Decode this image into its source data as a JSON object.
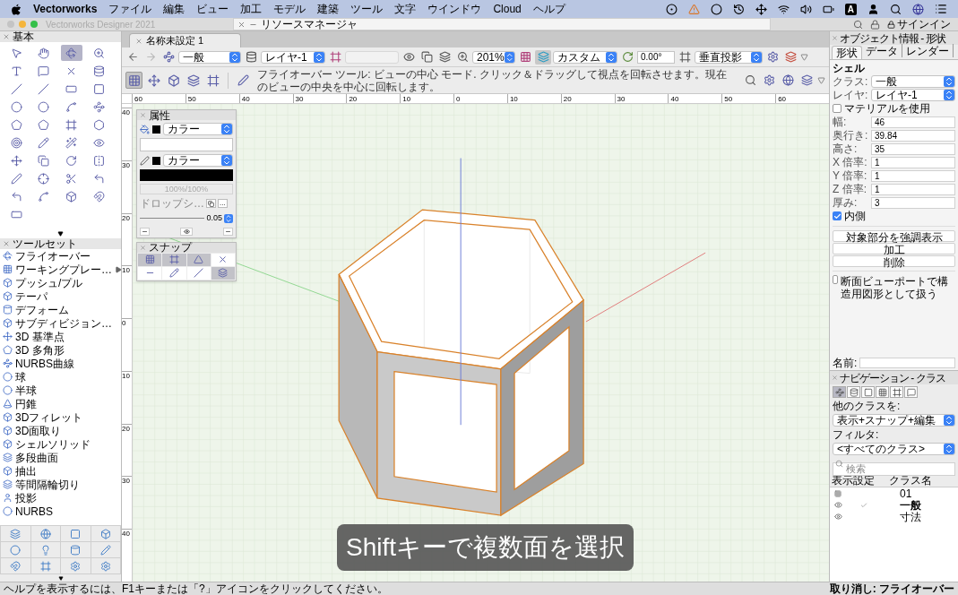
{
  "menu_bar": {
    "app": "Vectorworks",
    "items": [
      "ファイル",
      "編集",
      "ビュー",
      "加工",
      "モデル",
      "建築",
      "ツール",
      "文字",
      "ウインドウ",
      "Cloud",
      "ヘルプ"
    ],
    "input_mode": "A"
  },
  "window": {
    "title": "Vectorworks Designer 2021",
    "resource_manager": "リソースマネージャ",
    "sign_in": "サインイン"
  },
  "basic_palette": {
    "title": "基本",
    "tools": [
      {
        "selected": false
      },
      {
        "selected": false
      },
      {
        "selected": true
      },
      {
        "selected": false
      },
      {
        "selected": false
      },
      {
        "selected": false
      },
      {
        "selected": false
      },
      {
        "selected": false
      },
      {
        "selected": false
      },
      {
        "selected": false
      },
      {
        "selected": false
      },
      {
        "selected": false
      },
      {
        "selected": false
      },
      {
        "selected": false
      },
      {
        "selected": false
      },
      {
        "selected": false
      },
      {
        "selected": false
      },
      {
        "selected": false
      },
      {
        "selected": false
      },
      {
        "selected": false
      },
      {
        "selected": false
      },
      {
        "selected": false
      },
      {
        "selected": false
      },
      {
        "selected": false
      },
      {
        "selected": false
      },
      {
        "selected": false
      },
      {
        "selected": false
      },
      {
        "selected": false
      },
      {
        "selected": false
      },
      {
        "selected": false
      },
      {
        "selected": false
      },
      {
        "selected": false
      },
      {
        "selected": false
      },
      {
        "selected": false
      },
      {
        "selected": false
      },
      {
        "selected": false
      },
      {
        "selected": false
      }
    ]
  },
  "toolset": {
    "title": "ツールセット",
    "items": [
      {
        "label": "フライオーバー",
        "has_submenu": false
      },
      {
        "label": "ワーキングプレー…",
        "has_submenu": true
      },
      {
        "label": "プッシュ/プル",
        "has_submenu": false
      },
      {
        "label": "テーパ",
        "has_submenu": false
      },
      {
        "label": "デフォーム",
        "has_submenu": false
      },
      {
        "label": "サブディビジョン…",
        "has_submenu": false
      },
      {
        "label": "3D 基準点",
        "has_submenu": false
      },
      {
        "label": "3D 多角形",
        "has_submenu": false
      },
      {
        "label": "NURBS曲線",
        "has_submenu": false
      },
      {
        "label": "球",
        "has_submenu": false
      },
      {
        "label": "半球",
        "has_submenu": false
      },
      {
        "label": "円錐",
        "has_submenu": false
      },
      {
        "label": "3Dフィレット",
        "has_submenu": false
      },
      {
        "label": "3D面取り",
        "has_submenu": false
      },
      {
        "label": "シェルソリッド",
        "has_submenu": false
      },
      {
        "label": "多段曲面",
        "has_submenu": false
      },
      {
        "label": "抽出",
        "has_submenu": false
      },
      {
        "label": "等間隔輪切り",
        "has_submenu": false
      },
      {
        "label": "投影",
        "has_submenu": false
      },
      {
        "label": "NURBS",
        "has_submenu": false
      }
    ]
  },
  "document": {
    "tab": "名称未設定 1",
    "class": "一般",
    "layer": "レイヤ-1",
    "zoom": "201%",
    "view": "カスタム",
    "rotation": "0.00°",
    "projection": "垂直投影",
    "modes": [
      {
        "selected": true
      },
      {
        "selected": false
      },
      {
        "selected": false
      },
      {
        "selected": false
      },
      {
        "selected": false
      }
    ],
    "help_text": "フライオーバー ツール: ビューの中心 モード. クリック＆ドラッグして視点を回転させます。現在のビューの中央を中心に回転します。"
  },
  "rulers": {
    "horizontal": [
      "60",
      "50",
      "40",
      "30",
      "20",
      "10",
      "0",
      "10",
      "20",
      "30",
      "40",
      "50",
      "60"
    ],
    "vertical": [
      "40",
      "30",
      "20",
      "10",
      "0",
      "10",
      "20",
      "30",
      "40"
    ]
  },
  "attributes": {
    "title": "属性",
    "fill": "カラー",
    "pen": "カラー",
    "opacity": "100%/100%",
    "drop_shadow": "ドロップシ…",
    "more_button": "...",
    "line_weight": "0.05"
  },
  "snaps": {
    "title": "スナップ",
    "buttons": [
      {
        "on": true
      },
      {
        "on": true
      },
      {
        "on": true
      },
      {
        "on": false
      },
      {
        "on": false
      },
      {
        "on": false
      },
      {
        "on": false
      },
      {
        "on": true
      }
    ]
  },
  "caption": "Shiftキーで複数面を選択",
  "object_info": {
    "title": "オブジェクト情報 - 形状",
    "tabs": [
      {
        "label": "形状",
        "selected": true
      },
      {
        "label": "データ",
        "selected": false
      },
      {
        "label": "レンダー",
        "selected": false
      }
    ],
    "object_type": "シェル",
    "class_label": "クラス:",
    "class": "一般",
    "layer_label": "レイヤ:",
    "layer": "レイヤ-1",
    "use_material": {
      "label": "マテリアルを使用",
      "checked": false
    },
    "fields": [
      {
        "label": "幅:",
        "value": "46"
      },
      {
        "label": "奥行き:",
        "value": "39.84"
      },
      {
        "label": "高さ:",
        "value": "35"
      },
      {
        "label": "X 倍率:",
        "value": "1"
      },
      {
        "label": "Y 倍率:",
        "value": "1"
      },
      {
        "label": "Z 倍率:",
        "value": "1"
      },
      {
        "label": "厚み:",
        "value": "3"
      }
    ],
    "inside": {
      "label": "内側",
      "checked": true
    },
    "buttons": [
      "対象部分を強調表示",
      "加工",
      "削除"
    ],
    "section_viewport": {
      "label": "断面ビューポートで構造用図形として扱う",
      "checked": false
    },
    "name_label": "名前:"
  },
  "navigation": {
    "title": "ナビゲーション - クラス",
    "tabs": [
      {
        "selected": true
      },
      {
        "selected": false
      },
      {
        "selected": false
      },
      {
        "selected": false
      },
      {
        "selected": false
      },
      {
        "selected": false
      }
    ],
    "other_classes_label": "他のクラスを:",
    "other_classes": "表示+スナップ+編集",
    "filter_label": "フィルタ:",
    "filter": "<すべてのクラス>",
    "search_placeholder": "検索",
    "columns": [
      "表示設定",
      "クラス名"
    ],
    "rows": [
      {
        "name": "01",
        "kind": "group",
        "visible": false,
        "active": false
      },
      {
        "name": "一般",
        "kind": "class",
        "visible": true,
        "active": true
      },
      {
        "name": "寸法",
        "kind": "class",
        "visible": true,
        "active": false
      }
    ]
  },
  "status_bar": {
    "help": "ヘルプを表示するには、F1キーまたは「?」アイコンをクリックしてください。",
    "undo": "取り消し: フライオーバー"
  }
}
